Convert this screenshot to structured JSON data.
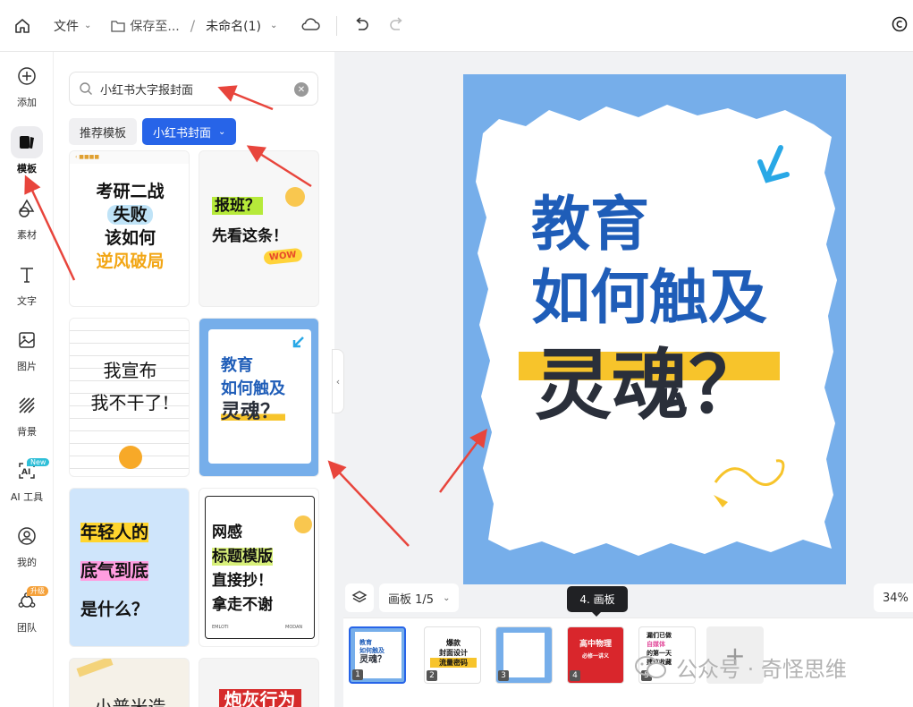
{
  "topbar": {
    "file_label": "文件",
    "save_label": "保存至...",
    "separator": "/",
    "doc_title": "未命名(1)"
  },
  "rail": [
    {
      "key": "add",
      "label": "添加",
      "icon": "plus-circle-icon"
    },
    {
      "key": "template",
      "label": "模板",
      "icon": "template-icon",
      "active": true
    },
    {
      "key": "material",
      "label": "素材",
      "icon": "shapes-icon"
    },
    {
      "key": "text",
      "label": "文字",
      "icon": "text-t-icon"
    },
    {
      "key": "image",
      "label": "图片",
      "icon": "image-icon"
    },
    {
      "key": "background",
      "label": "背景",
      "icon": "hatch-icon"
    },
    {
      "key": "ai",
      "label": "AI 工具",
      "icon": "ai-icon",
      "badge": "New"
    },
    {
      "key": "mine",
      "label": "我的",
      "icon": "user-icon"
    },
    {
      "key": "team",
      "label": "团队",
      "icon": "team-icon",
      "badge": "升级"
    }
  ],
  "search": {
    "value": "小红书大字报封面"
  },
  "tabs": {
    "recommend": "推荐模板",
    "current": "小红书封面"
  },
  "templates": {
    "t1": {
      "lines": [
        "考研二战",
        "失败",
        "该如何",
        "逆风破局"
      ]
    },
    "t2": {
      "lines": [
        "报班？",
        "先看这条！"
      ],
      "sticker": "WOW"
    },
    "t3": {
      "lines": [
        "我宣布",
        "我不干了!"
      ]
    },
    "t4": {
      "lines": [
        "教育",
        "如何触及",
        "灵魂？"
      ]
    },
    "t5": {
      "lines": [
        "年轻人的",
        "底气到底",
        "是什么？"
      ]
    },
    "t6": {
      "lines": [
        "网感",
        "标题模版",
        "直接抄！",
        "拿走不谢"
      ],
      "footer_left": "EMLOTI",
      "footer_right": "MODAN"
    },
    "t7": {
      "lines": [
        "小普米造"
      ]
    },
    "t8": {
      "lines": [
        "炮灰行为"
      ]
    }
  },
  "artboard": {
    "line1": "教育",
    "line2": "如何触及",
    "line3": "灵魂？"
  },
  "bottom": {
    "page_indicator": "画板 1/5",
    "zoom": "34%",
    "tooltip": "4. 画板"
  },
  "thumbs": [
    {
      "num": "1",
      "text": [
        "教育",
        "如何触及",
        "灵魂？"
      ]
    },
    {
      "num": "2",
      "text": [
        "爆款",
        "封面设计",
        "流量密码"
      ]
    },
    {
      "num": "3",
      "text": []
    },
    {
      "num": "4",
      "text": [
        "高中物理",
        "必修一讲义"
      ]
    },
    {
      "num": "5",
      "text": [
        "漏们已做",
        "自媒体",
        "的第一天",
        "建议收藏"
      ]
    }
  ],
  "watermark": {
    "text": "公众号 · 奇怪思维"
  },
  "colors": {
    "accent": "#2764e8",
    "artboard_bg": "#76aeea",
    "title_blue": "#1f5db8",
    "highlight_yellow": "#f7c42b",
    "annotation_red": "#e8453c"
  }
}
